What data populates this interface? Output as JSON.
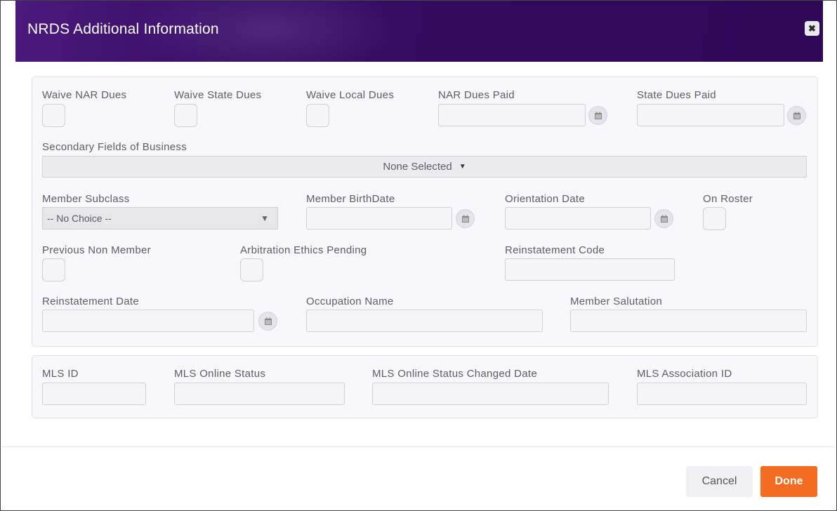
{
  "dialog": {
    "title": "NRDS Additional Information",
    "close_icon": "close-icon",
    "header_color": "#3b0f69"
  },
  "section1": {
    "waive_nar_dues_label": "Waive NAR Dues",
    "waive_state_dues_label": "Waive State Dues",
    "waive_local_dues_label": "Waive Local Dues",
    "nar_dues_paid_label": "NAR Dues Paid",
    "state_dues_paid_label": "State Dues Paid",
    "secondary_fields_label": "Secondary Fields of Business",
    "secondary_fields_value": "None Selected",
    "member_subclass_label": "Member Subclass",
    "member_subclass_value": "-- No Choice --",
    "member_birthdate_label": "Member BirthDate",
    "orientation_date_label": "Orientation Date",
    "on_roster_label": "On Roster",
    "previous_non_member_label": "Previous Non Member",
    "arbitration_ethics_label": "Arbitration Ethics Pending",
    "reinstatement_code_label": "Reinstatement Code",
    "reinstatement_date_label": "Reinstatement Date",
    "occupation_name_label": "Occupation Name",
    "member_salutation_label": "Member Salutation"
  },
  "section2": {
    "mls_id_label": "MLS ID",
    "mls_online_status_label": "MLS Online Status",
    "mls_online_status_changed_label": "MLS Online Status Changed Date",
    "mls_association_id_label": "MLS Association ID"
  },
  "footer": {
    "cancel_label": "Cancel",
    "done_label": "Done",
    "done_color": "#f26c21"
  }
}
